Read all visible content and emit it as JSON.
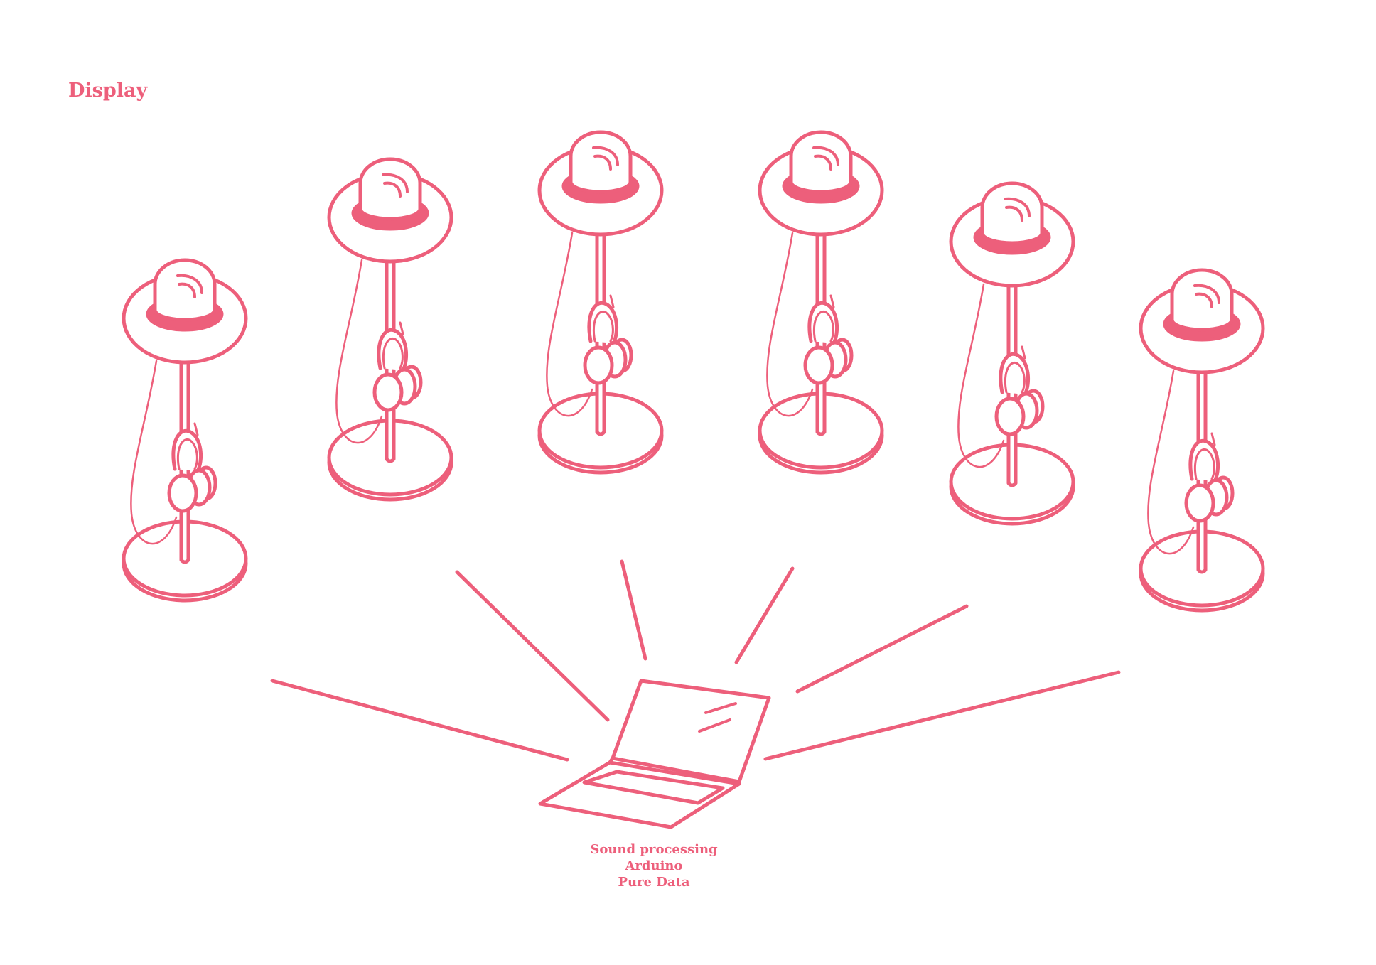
{
  "title": "Display",
  "accent_color": "#ed5f7b",
  "stations": [
    {
      "icon": "lamp-headphones-stand-icon"
    },
    {
      "icon": "lamp-headphones-stand-icon"
    },
    {
      "icon": "lamp-headphones-stand-icon"
    },
    {
      "icon": "lamp-headphones-stand-icon"
    },
    {
      "icon": "lamp-headphones-stand-icon"
    },
    {
      "icon": "lamp-headphones-stand-icon"
    }
  ],
  "hub": {
    "icon": "laptop-icon",
    "labels": [
      "Sound processing",
      "Arduino",
      "Pure Data"
    ]
  }
}
